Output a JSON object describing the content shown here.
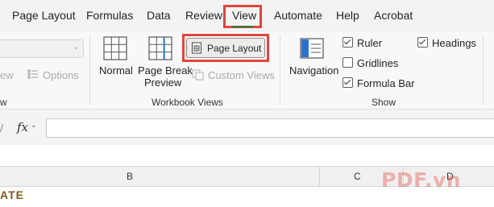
{
  "ribbon_tabs": {
    "page_layout": "Page Layout",
    "formulas": "Formulas",
    "data": "Data",
    "review": "Review",
    "view": "View",
    "automate": "Automate",
    "help": "Help",
    "acrobat": "Acrobat"
  },
  "sheet_view_group": {
    "view_label_partial": "ew",
    "options_label": "Options",
    "group_label_partial": "w"
  },
  "workbook_views": {
    "normal": "Normal",
    "page_break_line1": "Page Break",
    "page_break_line2": "Preview",
    "page_layout": "Page Layout",
    "custom_views": "Custom Views",
    "group_label": "Workbook Views"
  },
  "show_group": {
    "navigation": "Navigation",
    "ruler": {
      "label": "Ruler",
      "checked": true
    },
    "gridlines": {
      "label": "Gridlines",
      "checked": false
    },
    "formula_bar": {
      "label": "Formula Bar",
      "checked": true
    },
    "headings": {
      "label": "Headings",
      "checked": true
    },
    "group_label": "Show"
  },
  "formula_bar": {
    "fx_label": "fx",
    "value": ""
  },
  "column_headers": [
    "B",
    "C",
    "D"
  ],
  "cell_text_partial": "ATE",
  "watermark": "PDF.vn",
  "colors": {
    "highlight_red": "#e0463c",
    "active_tab_underline": "#1a7f37",
    "disabled_text": "#a9a9a9"
  }
}
